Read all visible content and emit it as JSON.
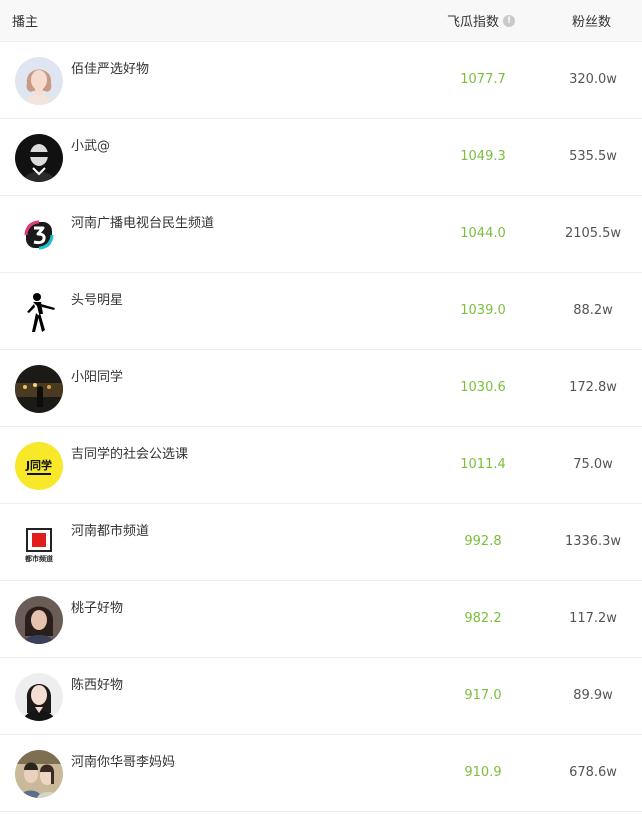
{
  "header": {
    "col_host": "播主",
    "col_index": "飞瓜指数",
    "col_fans": "粉丝数",
    "info_glyph": "!"
  },
  "rows": [
    {
      "name": "佰佳严选好物",
      "index": "1077.7",
      "fans": "320.0w",
      "avatar_icon": "woman-portrait-icon"
    },
    {
      "name": "小武@",
      "index": "1049.3",
      "fans": "535.5w",
      "avatar_icon": "man-sunglasses-icon"
    },
    {
      "name": "河南广播电视台民生频道",
      "index": "1044.0",
      "fans": "2105.5w",
      "avatar_icon": "channel-3-logo-icon"
    },
    {
      "name": "头号明星",
      "index": "1039.0",
      "fans": "88.2w",
      "avatar_icon": "dancer-silhouette-icon"
    },
    {
      "name": "小阳同学",
      "index": "1030.6",
      "fans": "172.8w",
      "avatar_icon": "night-street-icon"
    },
    {
      "name": "吉同学的社会公选课",
      "index": "1011.4",
      "fans": "75.0w",
      "avatar_icon": "j-tongxue-logo-icon",
      "avatar_logo_text": "J同学"
    },
    {
      "name": "河南都市频道",
      "index": "992.8",
      "fans": "1336.3w",
      "avatar_icon": "dushi-channel-logo-icon",
      "avatar_logo_text": "都市频道"
    },
    {
      "name": "桃子好物",
      "index": "982.2",
      "fans": "117.2w",
      "avatar_icon": "woman-portrait-icon"
    },
    {
      "name": "陈西好物",
      "index": "917.0",
      "fans": "89.9w",
      "avatar_icon": "woman-portrait-icon"
    },
    {
      "name": "河南你华哥李妈妈",
      "index": "910.9",
      "fans": "678.6w",
      "avatar_icon": "couple-photo-icon"
    }
  ]
}
